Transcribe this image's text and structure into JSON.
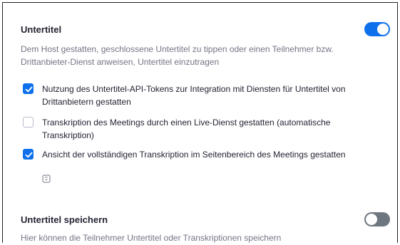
{
  "captions": {
    "title": "Untertitel",
    "enabled": true,
    "description": "Dem Host gestatten, geschlossene Untertitel zu tippen oder einen Teilnehmer bzw. Drittanbieter-Dienst anweisen, Untertitel einzutragen",
    "options": [
      {
        "label": "Nutzung des Untertitel-API-Tokens zur Integration mit Diensten für Untertitel von Drittanbietern gestatten",
        "checked": true
      },
      {
        "label": "Transkription des Meetings durch einen Live-Dienst gestatten (automatische Transkription)",
        "checked": false
      },
      {
        "label": "Ansicht der vollständigen Transkription im Seitenbereich des Meetings gestatten",
        "checked": true,
        "icon": "info-icon"
      }
    ]
  },
  "save_captions": {
    "title": "Untertitel speichern",
    "enabled": false,
    "description": "Hier können die Teilnehmer Untertitel oder Transkriptionen speichern"
  },
  "colors": {
    "accent": "#0e71eb",
    "toggle_off": "#6e7680",
    "muted_text": "#747487"
  }
}
